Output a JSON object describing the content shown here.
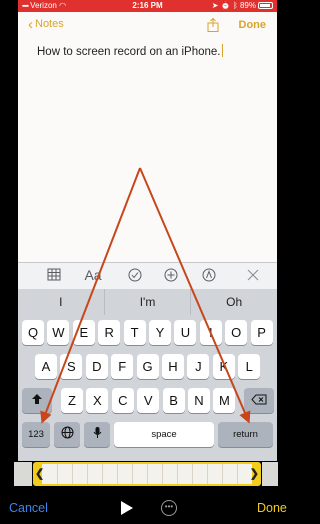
{
  "statusbar": {
    "carrier": "Verizon",
    "time": "2:16 PM",
    "battery": "89%"
  },
  "notes": {
    "back_label": "Notes",
    "done_label": "Done",
    "note_text": "How to screen record on an iPhone."
  },
  "keyboard": {
    "format_icons": [
      "table-icon",
      "Aa",
      "checklist-icon",
      "add-icon",
      "markup-icon",
      "close-icon"
    ],
    "format_aa": "Aa",
    "suggestions": [
      "I",
      "I'm",
      "Oh"
    ],
    "row1": [
      "Q",
      "W",
      "E",
      "R",
      "T",
      "Y",
      "U",
      "I",
      "O",
      "P"
    ],
    "row2": [
      "A",
      "S",
      "D",
      "F",
      "G",
      "H",
      "J",
      "K",
      "L"
    ],
    "row3": [
      "Z",
      "X",
      "C",
      "V",
      "B",
      "N",
      "M"
    ],
    "numbers_label": "123",
    "space_label": "space",
    "return_label": "return"
  },
  "editor": {
    "cancel_label": "Cancel",
    "done_label": "Done"
  },
  "colors": {
    "recording_bar": "#e0312e",
    "notes_accent": "#d7a52c",
    "arrow": "#c8461c",
    "trim_handle": "#f2cd1b",
    "cancel_blue": "#3b85ef"
  }
}
